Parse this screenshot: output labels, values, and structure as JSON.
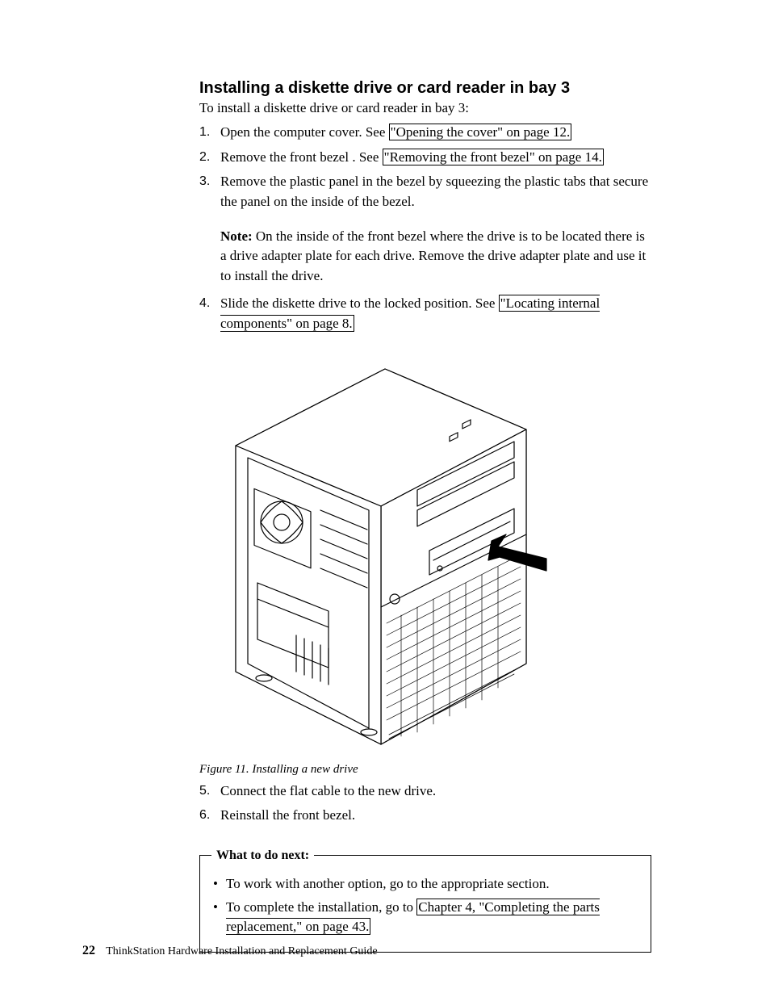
{
  "heading": "Installing a diskette drive or card reader in bay 3",
  "intro": "To install a diskette drive or card reader in bay 3:",
  "steps": {
    "s1a": "Open the computer cover. See ",
    "s1link": "\"Opening the cover\" on page 12.",
    "s2a": "Remove the front bezel . See ",
    "s2link": "\"Removing the front bezel\" on page 14.",
    "s3": "Remove the plastic panel in the bezel by squeezing the plastic tabs that secure the panel on the inside of the bezel.",
    "note_label": "Note:",
    "note_body": " On the inside of the front bezel where the drive is to be located there is a drive adapter plate for each drive. Remove the drive adapter plate and use it to install the drive.",
    "s4a": "Slide the diskette drive to the locked position. See ",
    "s4link": "\"Locating internal components\" on page 8.",
    "s5": "Connect the flat cable to the new drive.",
    "s6": "Reinstall the front bezel."
  },
  "figure_caption": "Figure 11. Installing a new drive",
  "nextbox": {
    "legend": "What to do next:",
    "item1": "To work with another option, go to the appropriate section.",
    "item2a": "To complete the installation, go to ",
    "item2link": "Chapter 4, \"Completing the parts replacement,\" on page 43."
  },
  "footer": {
    "page_number": "22",
    "doc_title": "ThinkStation Hardware Installation and Replacement Guide"
  }
}
